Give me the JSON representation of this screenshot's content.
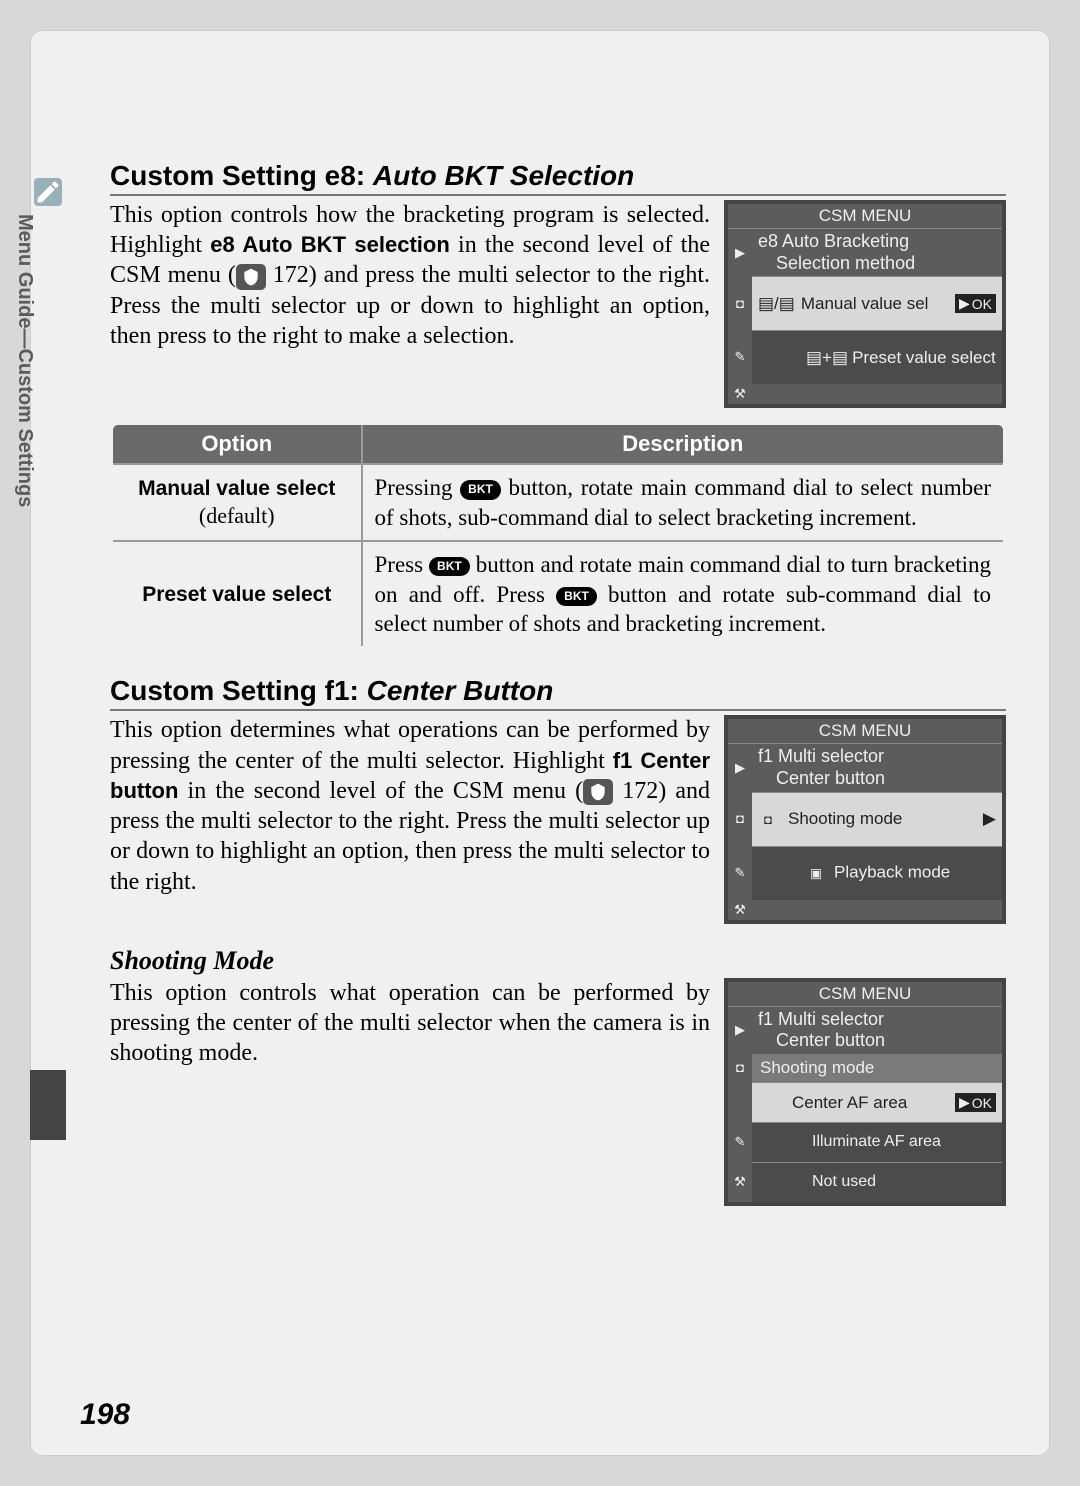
{
  "side_tab": "Menu Guide—Custom Settings",
  "page_number": "198",
  "e8": {
    "heading_prefix": "Custom Setting e8: ",
    "heading_italic": "Auto BKT Selection",
    "para_a": "This option controls how the bracketing program is selected.  Highlight ",
    "para_b_bold": "e8 Auto BKT selection",
    "para_c": " in the second level of the CSM menu (",
    "page_ref": " 172) and press the multi selector to the right.  Press the multi selector up or down to highlight an option, then press to the right to make a selection.",
    "lcd": {
      "title": "CSM MENU",
      "hdr1": "e8  Auto Bracketing",
      "hdr2": "Selection method",
      "opt1": "Manual value sel",
      "opt2": "Preset value select",
      "ok": "OK"
    },
    "table": {
      "th_option": "Option",
      "th_desc": "Description",
      "rows": [
        {
          "name": "Manual value select",
          "default": "(default)",
          "bkt": "BKT",
          "desc_a": "Pressing ",
          "desc_b": " button, rotate main command dial to select number of shots, sub-command dial to select bracketing increment."
        },
        {
          "name": "Preset value select",
          "default": "",
          "bkt1": "BKT",
          "bkt2": "BKT",
          "desc_a": "Press ",
          "desc_b": " button and rotate main command dial to turn bracketing on and off.  Press ",
          "desc_c": " button and rotate sub-command dial to select number of shots and bracketing increment."
        }
      ]
    }
  },
  "f1": {
    "heading_prefix": "Custom Setting f1: ",
    "heading_italic": "Center Button",
    "para_a": "This option determines what operations can be performed by pressing the center of the multi selector.  Highlight ",
    "para_b_bold": "f1 Center button",
    "para_c": " in the second level of the CSM menu (",
    "page_ref": " 172) and press the multi selector to the right.  Press the multi selector up or down to highlight an option, then press the multi selector to the right.",
    "lcd": {
      "title": "CSM MENU",
      "hdr1": "f1  Multi selector",
      "hdr2": "Center button",
      "opt1": "Shooting mode",
      "opt2": "Playback mode"
    },
    "shooting": {
      "heading": "Shooting Mode",
      "para": "This option controls what operation can be performed by pressing the center of the multi selector when the camera is in shooting mode.",
      "lcd": {
        "title": "CSM MENU",
        "hdr1": "f1  Multi selector",
        "hdr2": "Center button",
        "hdr3": "Shooting mode",
        "opt1": "Center AF area",
        "opt2": "Illuminate AF area",
        "opt3": "Not used",
        "ok": "OK"
      }
    }
  }
}
